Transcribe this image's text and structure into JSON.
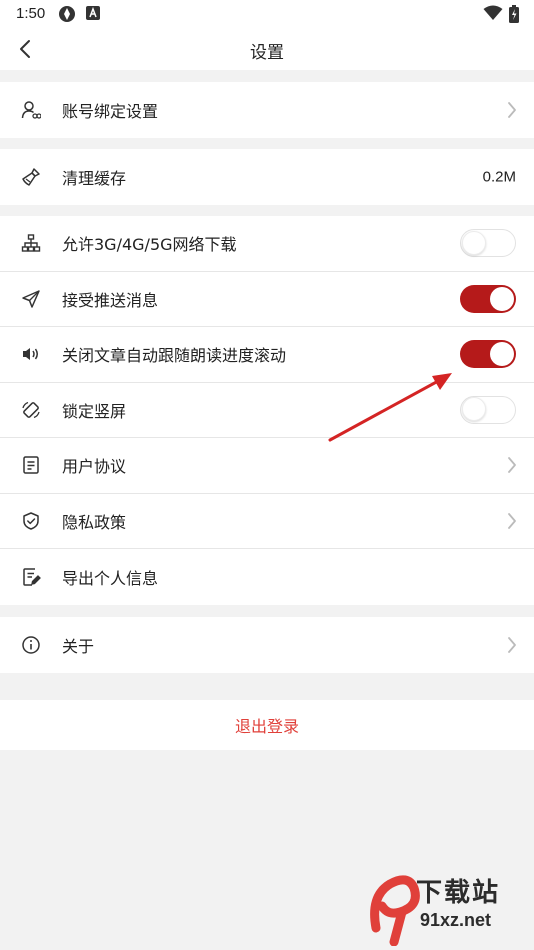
{
  "status": {
    "time": "1:50"
  },
  "nav": {
    "title": "设置"
  },
  "groups": {
    "account": {
      "label": "账号绑定设置"
    },
    "cache": {
      "label": "清理缓存",
      "value": "0.2M"
    },
    "settings": [
      {
        "label": "允许3G/4G/5G网络下载",
        "icon": "network-icon",
        "toggle": false
      },
      {
        "label": "接受推送消息",
        "icon": "send-icon",
        "toggle": true
      },
      {
        "label": "关闭文章自动跟随朗读进度滚动",
        "icon": "speaker-icon",
        "toggle": true
      },
      {
        "label": "锁定竖屏",
        "icon": "rotate-icon",
        "toggle": false
      },
      {
        "label": "用户协议",
        "icon": "document-icon"
      },
      {
        "label": "隐私政策",
        "icon": "shield-icon"
      },
      {
        "label": "导出个人信息",
        "icon": "export-icon"
      }
    ],
    "about": {
      "label": "关于"
    }
  },
  "logout": {
    "label": "退出登录"
  },
  "watermark": {
    "brand": "下载站",
    "url": "91xz.net"
  },
  "colors": {
    "accent": "#b51a1a",
    "logout": "#e0403a",
    "background": "#f2f2f2"
  }
}
